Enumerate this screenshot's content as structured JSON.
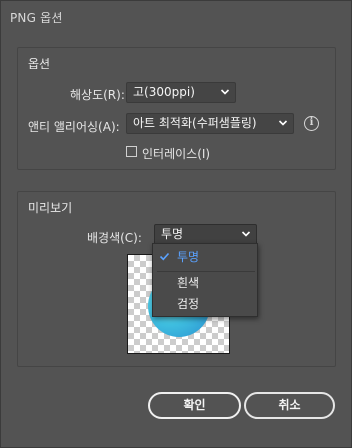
{
  "window": {
    "title": "PNG 옵션"
  },
  "options": {
    "section_title": "옵션",
    "resolution": {
      "label": "해상도(R):",
      "value": "고(300ppi)"
    },
    "antialias": {
      "label": "앤티 앨리어싱(A):",
      "value": "아트 최적화(수퍼샘플링)"
    },
    "interlace": {
      "label": "인터레이스(I)",
      "checked": false
    }
  },
  "preview": {
    "section_title": "미리보기",
    "background": {
      "label": "배경색(C):",
      "value": "투명",
      "options": [
        {
          "label": "투명",
          "selected": true
        },
        {
          "label": "흰색",
          "selected": false
        },
        {
          "label": "검정",
          "selected": false
        }
      ]
    }
  },
  "buttons": {
    "ok": "확인",
    "cancel": "취소"
  },
  "colors": {
    "dialog_bg": "#535353",
    "selected_item": "#5aa2ff",
    "preview_circle": "#3fbfe0"
  },
  "icons": {
    "info": "info-icon",
    "dropdown": "chevron-down-icon",
    "check": "check-icon"
  }
}
